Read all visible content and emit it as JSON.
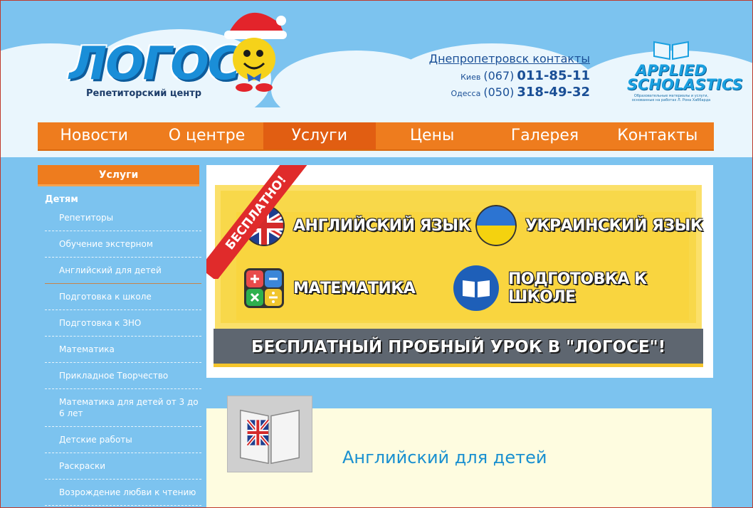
{
  "header": {
    "logo_text": "ЛОГОС",
    "logo_subtitle": "Репетиторский центр",
    "contacts_link": "Днепропетровск контакты",
    "phones": [
      {
        "city": "Киев",
        "code": "(067)",
        "number": "011-85-11"
      },
      {
        "city": "Одесса",
        "code": "(050)",
        "number": "318-49-32"
      }
    ],
    "partner_logo_line1": "APPLIED",
    "partner_logo_line2": "SCHOLASTICS",
    "partner_caption": "Образовательные материалы и услуги, основанные на работах Л. Рона Хаббарда"
  },
  "nav": {
    "items": [
      "Новости",
      "О центре",
      "Услуги",
      "Цены",
      "Галерея",
      "Контакты"
    ],
    "active": "Услуги"
  },
  "sidebar": {
    "title": "Услуги",
    "category": "Детям",
    "items": [
      "Репетиторы",
      "Обучение экстерном",
      "Английский для детей",
      "Подготовка к школе",
      "Подготовка к ЗНО",
      "Математика",
      "Прикладное Творчество",
      "Математика для детей от 3 до 6 лет",
      "Детские работы",
      "Раскраски",
      "Возрождение любви к чтению"
    ],
    "active": "Английский для детей"
  },
  "banner": {
    "ribbon": "БЕСПЛАТНО!",
    "courses": [
      "АНГЛИЙСКИЙ ЯЗЫК",
      "УКРАИНСКИЙ ЯЗЫК",
      "МАТЕМАТИКА",
      "ПОДГОТОВКА К ШКОЛЕ"
    ],
    "bottom_text": "БЕСПЛАТНЫЙ ПРОБНЫЙ УРОК В \"ЛОГОСЕ\"!"
  },
  "content": {
    "title": "Английский для детей"
  },
  "colors": {
    "sky": "#7cc3ef",
    "nav_orange": "#ee7c1e",
    "nav_active": "#e15e12",
    "banner_yellow": "#f9d53f",
    "link_blue": "#1a4f96"
  }
}
